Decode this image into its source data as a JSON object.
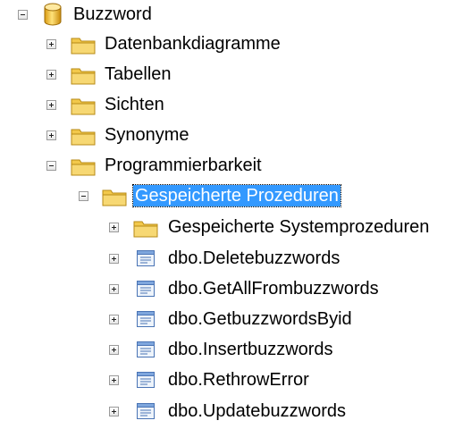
{
  "tree": {
    "root": {
      "label": "Buzzword",
      "icon": "database-icon",
      "expanded": true
    },
    "nodes": [
      {
        "label": "Datenbankdiagramme",
        "icon": "folder-icon",
        "expanded": false
      },
      {
        "label": "Tabellen",
        "icon": "folder-icon",
        "expanded": false
      },
      {
        "label": "Sichten",
        "icon": "folder-icon",
        "expanded": false
      },
      {
        "label": "Synonyme",
        "icon": "folder-icon",
        "expanded": false
      },
      {
        "label": "Programmierbarkeit",
        "icon": "folder-icon",
        "expanded": true
      },
      {
        "label": "Gespeicherte Prozeduren",
        "icon": "folder-icon",
        "expanded": true,
        "selected": true
      },
      {
        "label": "Gespeicherte Systemprozeduren",
        "icon": "folder-icon",
        "expanded": false
      },
      {
        "label": "dbo.Deletebuzzwords",
        "icon": "stored-procedure-icon",
        "expanded": false
      },
      {
        "label": "dbo.GetAllFrombuzzwords",
        "icon": "stored-procedure-icon",
        "expanded": false
      },
      {
        "label": "dbo.GetbuzzwordsByid",
        "icon": "stored-procedure-icon",
        "expanded": false
      },
      {
        "label": "dbo.Insertbuzzwords",
        "icon": "stored-procedure-icon",
        "expanded": false
      },
      {
        "label": "dbo.RethrowError",
        "icon": "stored-procedure-icon",
        "expanded": false
      },
      {
        "label": "dbo.Updatebuzzwords",
        "icon": "stored-procedure-icon",
        "expanded": false
      }
    ]
  },
  "colors": {
    "selection": "#3399ff",
    "folder": "#f2c84b",
    "database": "#f0b429"
  }
}
